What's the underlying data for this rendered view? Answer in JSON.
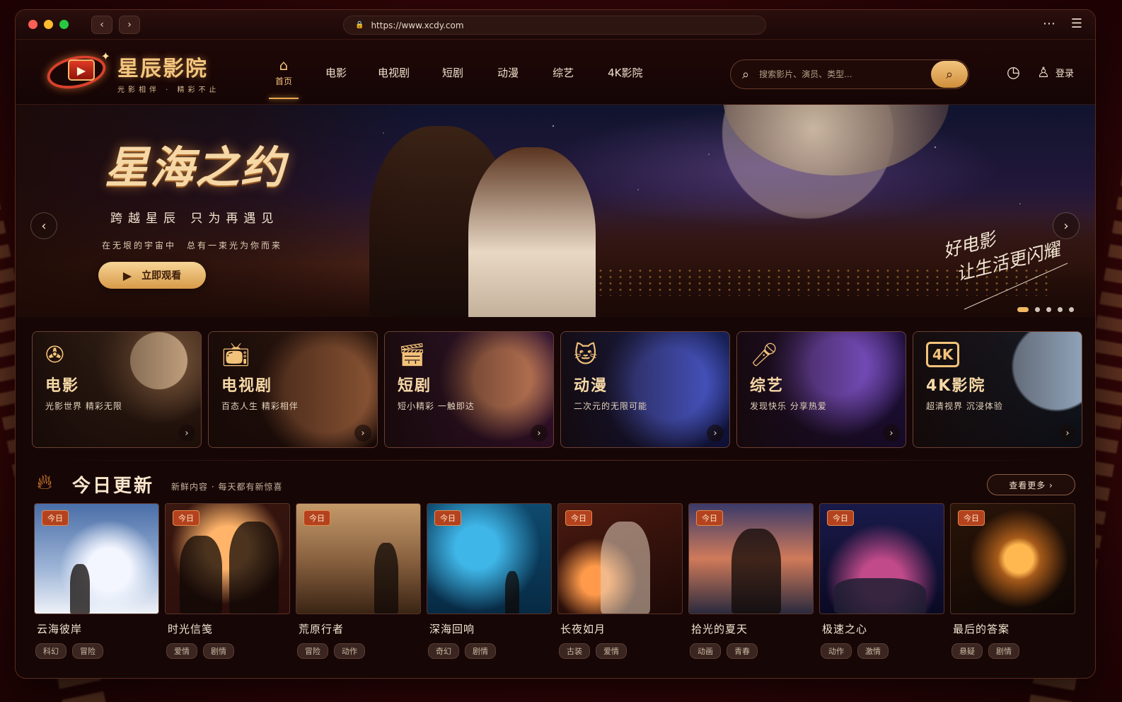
{
  "browser": {
    "url": "https://www.xcdy.com"
  },
  "site": {
    "name": "星辰影院",
    "tagline": "光影相伴 · 精彩不止"
  },
  "nav": {
    "home": "首页",
    "items": [
      "电影",
      "电视剧",
      "短剧",
      "动漫",
      "综艺",
      "4K影院"
    ]
  },
  "search": {
    "placeholder": "搜索影片、演员、类型..."
  },
  "header": {
    "login": "登录"
  },
  "hero": {
    "title": "星海之约",
    "subtitle": "跨越星辰 只为再遇见",
    "description": "在无垠的宇宙中　总有一束光为你而来",
    "cta": "立即观看",
    "slogan_line1": "好电影",
    "slogan_line2": "让生活更闪耀",
    "slide_count": 5,
    "active_slide": 1
  },
  "categories": [
    {
      "name": "电影",
      "desc": "光影世界 精彩无限",
      "icon": "film-reel-icon"
    },
    {
      "name": "电视剧",
      "desc": "百态人生 精彩相伴",
      "icon": "tv-icon"
    },
    {
      "name": "短剧",
      "desc": "短小精彩 一触即达",
      "icon": "clapperboard-icon"
    },
    {
      "name": "动漫",
      "desc": "二次元的无限可能",
      "icon": "cat-icon"
    },
    {
      "name": "综艺",
      "desc": "发现快乐 分享热爱",
      "icon": "microphone-icon"
    },
    {
      "name": "4K影院",
      "desc": "超清视界 沉浸体验",
      "icon": "4k-icon"
    }
  ],
  "today": {
    "title": "今日更新",
    "subtitle": "新鲜内容 · 每天都有新惊喜",
    "more": "查看更多 ›",
    "badge": "今日",
    "movies": [
      {
        "title": "云海彼岸",
        "tags": [
          "科幻",
          "冒险"
        ]
      },
      {
        "title": "时光信笺",
        "tags": [
          "爱情",
          "剧情"
        ]
      },
      {
        "title": "荒原行者",
        "tags": [
          "冒险",
          "动作"
        ]
      },
      {
        "title": "深海回响",
        "tags": [
          "奇幻",
          "剧情"
        ]
      },
      {
        "title": "长夜如月",
        "tags": [
          "古装",
          "爱情"
        ]
      },
      {
        "title": "拾光的夏天",
        "tags": [
          "动画",
          "青春"
        ]
      },
      {
        "title": "极速之心",
        "tags": [
          "动作",
          "激情"
        ]
      },
      {
        "title": "最后的答案",
        "tags": [
          "悬疑",
          "剧情"
        ]
      }
    ]
  }
}
